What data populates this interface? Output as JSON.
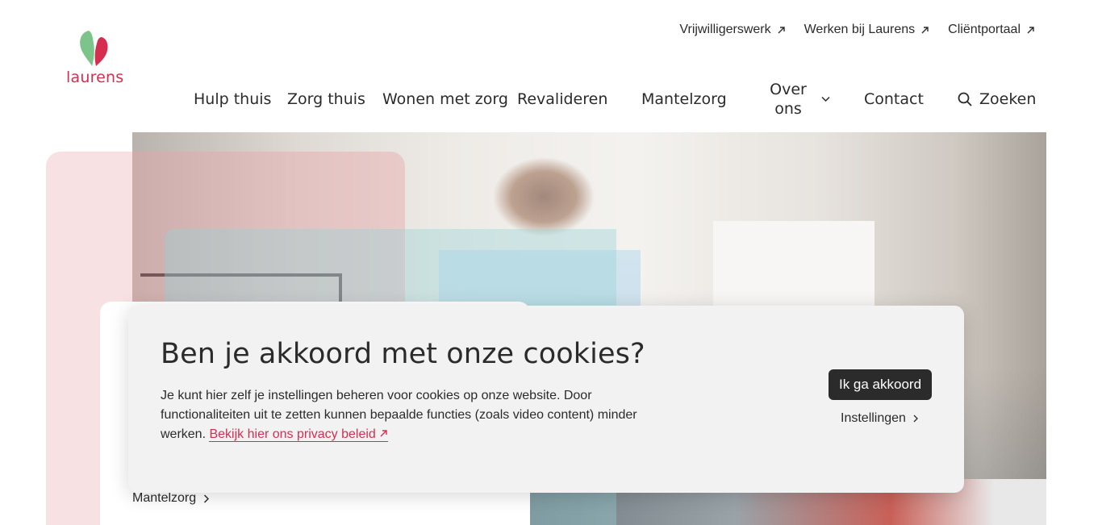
{
  "brand": {
    "name": "laurens",
    "logo_icon": "heart-leaf-logo",
    "colors": {
      "brand_red": "#d62e51",
      "brand_green": "#7cc48a",
      "pink_bg": "#f8e1e2",
      "dark": "#2b2b2b"
    }
  },
  "top_links": [
    {
      "label": "Vrijwilligerswerk",
      "icon": "external-link-icon"
    },
    {
      "label": "Werken bij Laurens",
      "icon": "external-link-icon"
    },
    {
      "label": "Cliëntportaal",
      "icon": "external-link-icon"
    }
  ],
  "main_nav": {
    "items": [
      "Hulp thuis",
      "Zorg thuis",
      "Wonen met zorg",
      "Revalideren",
      "Mantelzorg",
      "Over ons",
      "Contact"
    ],
    "search_label": "Zoeken"
  },
  "breadcrumb": {
    "label": "Mantelzorg"
  },
  "cookie": {
    "title": "Ben je akkoord met onze cookies?",
    "text": "Je kunt hier zelf je instellingen beheren voor cookies op onze website. Door functionaliteiten uit te zetten kunnen bepaalde functies (zoals video content) minder werken.",
    "privacy_link": "Bekijk hier ons privacy beleid",
    "accept_label": "Ik ga akkoord",
    "settings_label": "Instellingen"
  }
}
